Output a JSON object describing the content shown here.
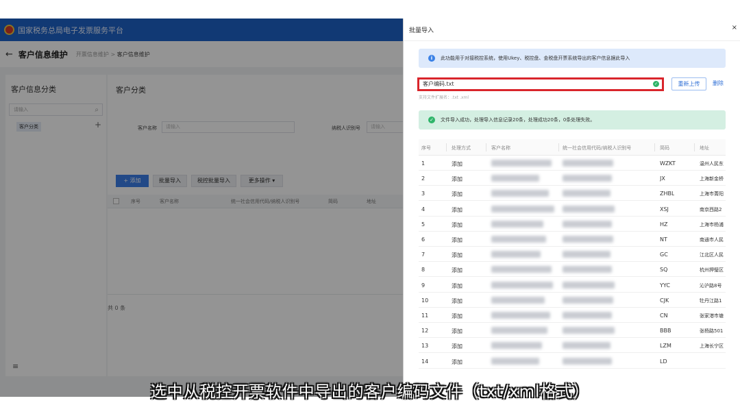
{
  "app": {
    "title": "国家税务总局电子发票服务平台",
    "page_title": "客户信息维护",
    "breadcrumb_parent": "开票信息维护",
    "breadcrumb_sep": ">",
    "breadcrumb_current": "客户信息维护",
    "left_panel": {
      "title": "客户信息分类",
      "search_placeholder": "请输入",
      "node": "客户分类",
      "add": "+"
    },
    "right_panel": {
      "title": "客户分类",
      "customer_name_label": "客户名称",
      "customer_name_placeholder": "请输入",
      "tax_id_label": "纳税人识别号",
      "tax_id_placeholder": "请输入",
      "buttons": {
        "add": "+ 添加",
        "batch_import": "批量导入",
        "tax_batch_import": "税控批量导入",
        "more": "更多操作 ▾"
      },
      "columns": [
        "序号",
        "客户名称",
        "统一社会信用代码/纳税人识别号",
        "简码",
        "地址"
      ],
      "total": "共 0 条"
    }
  },
  "drawer": {
    "title": "批量导入",
    "close": "×",
    "info": "此功能用于对接税控系统，使用Ukey、税控盘、金税盘开票系统导出的客户信息据此导入",
    "file_name": "客户编码.txt",
    "file_hint": "支持文件扩展名：.txt .xml",
    "reupload": "重新上传",
    "delete": "删除",
    "success": "文件导入成功，处理导入信息记录20条，处理成功20条，0条处理失败。",
    "columns": [
      "序号",
      "处理方式",
      "客户名称",
      "统一社会信用代码/纳税人识别号",
      "简码",
      "地址"
    ],
    "rows": [
      {
        "no": "1",
        "method": "添加",
        "code": "WZKT",
        "addr": "温州人民东"
      },
      {
        "no": "2",
        "method": "添加",
        "code": "JX",
        "addr": "上海新金桥"
      },
      {
        "no": "3",
        "method": "添加",
        "code": "ZHBL",
        "addr": "上海市菁阳"
      },
      {
        "no": "4",
        "method": "添加",
        "code": "XSJ",
        "addr": "南京西路2"
      },
      {
        "no": "5",
        "method": "添加",
        "code": "HZ",
        "addr": "上海市杨浦"
      },
      {
        "no": "6",
        "method": "添加",
        "code": "NT",
        "addr": "南通市人民"
      },
      {
        "no": "7",
        "method": "添加",
        "code": "GC",
        "addr": "江北区人民"
      },
      {
        "no": "8",
        "method": "添加",
        "code": "SQ",
        "addr": "杭州押璧区"
      },
      {
        "no": "9",
        "method": "添加",
        "code": "YYC",
        "addr": "沁沪路8号"
      },
      {
        "no": "10",
        "method": "添加",
        "code": "CJK",
        "addr": "牡丹江路1"
      },
      {
        "no": "11",
        "method": "添加",
        "code": "CN",
        "addr": "张家港市塘"
      },
      {
        "no": "12",
        "method": "添加",
        "code": "BBB",
        "addr": "张杨路501"
      },
      {
        "no": "13",
        "method": "添加",
        "code": "LZM",
        "addr": "上海长宁区"
      },
      {
        "no": "14",
        "method": "添加",
        "code": "LD",
        "addr": ""
      }
    ]
  },
  "caption": "选中从税控开票软件中导出的客户编码文件（txt/xml格式）"
}
